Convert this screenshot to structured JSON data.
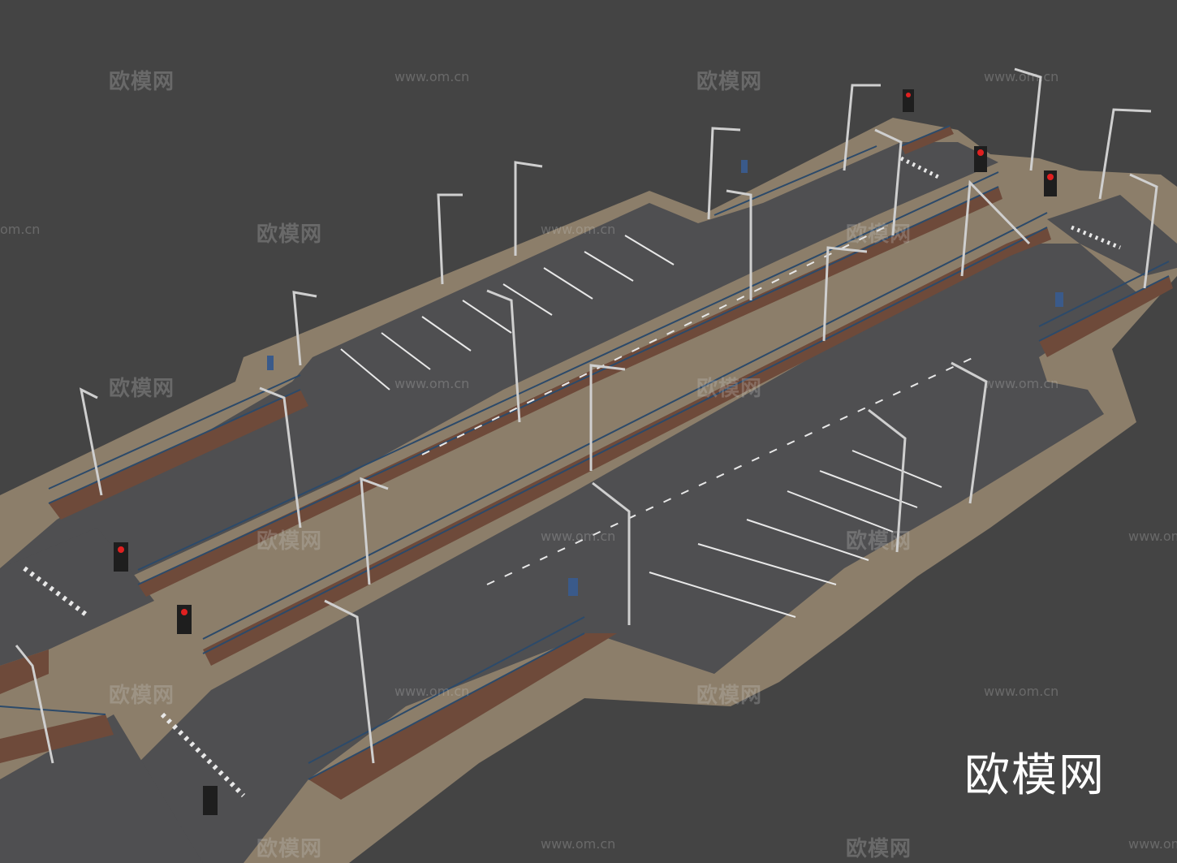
{
  "watermark": {
    "brand_text": "欧模网",
    "url_text": "www.om.cn",
    "partial_url_text": "om.cn"
  },
  "colors": {
    "background": "#444444",
    "asphalt": "#4f4f51",
    "sidewalk": "#8c7e6a",
    "planter_soil": "#6e4a3a",
    "fence": "#2c4a6a",
    "road_marking": "#e8e8e8",
    "lamp_pole": "#cfcfcf",
    "signal_red": "#e02020"
  }
}
